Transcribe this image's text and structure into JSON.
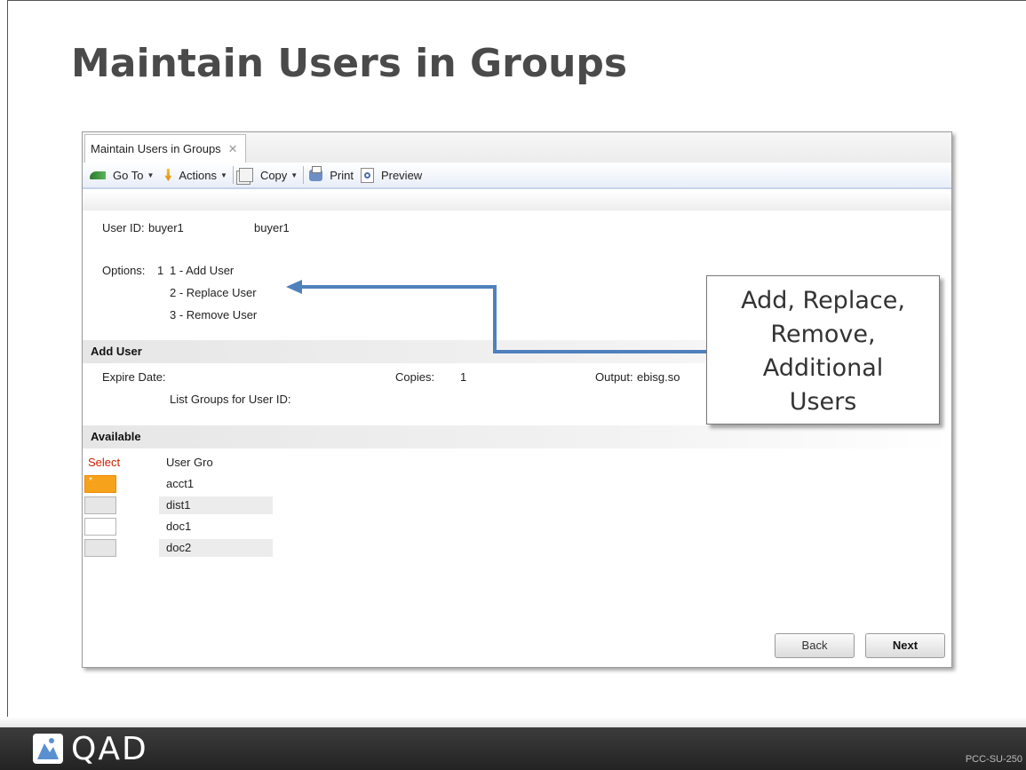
{
  "slide": {
    "title": "Maintain Users in Groups",
    "code": "PCC-SU-250",
    "brand": "QAD"
  },
  "window": {
    "tab_label": "Maintain Users in Groups",
    "tab_close": "✕"
  },
  "toolbar": {
    "goto_label": "Go To",
    "actions_label": "Actions",
    "copy_label": "Copy",
    "print_label": "Print",
    "preview_label": "Preview",
    "caret": "▼"
  },
  "form": {
    "user_id_label": "User ID:",
    "user_id_value": "buyer1",
    "user_name": "buyer1",
    "options_label": "Options:",
    "options_value": "1",
    "option_items": [
      "1 - Add User",
      "2 - Replace User",
      "3 - Remove User"
    ]
  },
  "add_user": {
    "section_title": "Add User",
    "expire_date_label": "Expire Date:",
    "copies_label": "Copies:",
    "copies_value": "1",
    "output_label": "Output:",
    "output_value": "ebisg.so",
    "list_groups_label": "List Groups for User ID:"
  },
  "available": {
    "section_title": "Available",
    "select_header": "Select",
    "group_header": "User Gro",
    "rows": [
      {
        "mark": "*",
        "group": "acct1"
      },
      {
        "mark": "",
        "group": "dist1"
      },
      {
        "mark": "",
        "group": "doc1"
      },
      {
        "mark": "",
        "group": "doc2"
      }
    ]
  },
  "buttons": {
    "back": "Back",
    "next": "Next"
  },
  "callout": {
    "lines": [
      "Add, Replace,",
      "Remove,",
      "Additional",
      "Users"
    ]
  },
  "colors": {
    "arrow": "#4f81bd",
    "selected_row": "#f7a21b",
    "select_header": "#cc2200"
  }
}
